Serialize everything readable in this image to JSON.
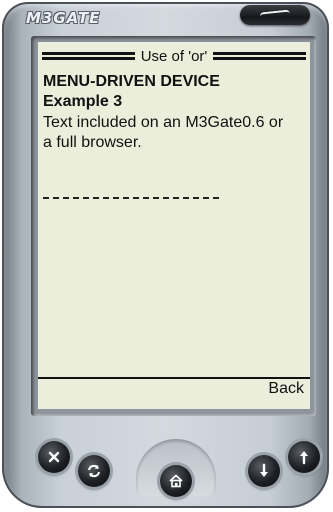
{
  "device": {
    "brand": "M3GATE"
  },
  "screen": {
    "title": "Use of 'or'",
    "heading_line1": "MENU-DRIVEN DEVICE",
    "heading_line2": "Example 3",
    "body": "Text included on an M3Gate0.6 or a full browser.",
    "back_label": "Back"
  },
  "hardware_buttons": [
    {
      "name": "close",
      "icon": "close-icon"
    },
    {
      "name": "refresh",
      "icon": "refresh-icon"
    },
    {
      "name": "home",
      "icon": "home-icon"
    },
    {
      "name": "down",
      "icon": "arrow-down-icon"
    },
    {
      "name": "up",
      "icon": "arrow-up-icon"
    }
  ],
  "colors": {
    "screen_bg": "#eceedc",
    "device_body": "#c9d0d7",
    "button_dark": "#1d2024"
  }
}
